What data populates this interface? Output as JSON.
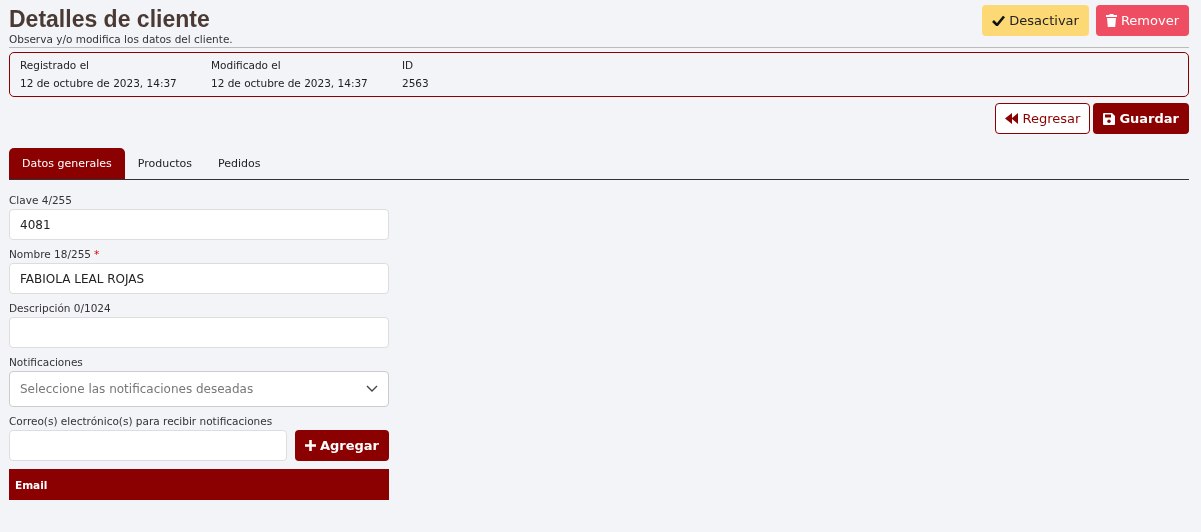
{
  "header": {
    "title": "Detalles de cliente",
    "subtitle": "Observa y/o modifica los datos del cliente."
  },
  "top_actions": [
    {
      "label": "Desactivar",
      "kind": "warning"
    },
    {
      "label": "Remover",
      "kind": "danger"
    }
  ],
  "info": [
    {
      "label": "Registrado el",
      "value": "12 de octubre de 2023, 14:37"
    },
    {
      "label": "Modificado el",
      "value": "12 de octubre de 2023, 14:37"
    },
    {
      "label": "ID",
      "value": "2563"
    }
  ],
  "form_actions": [
    {
      "label": "Regresar",
      "kind": "back"
    },
    {
      "label": "Guardar",
      "kind": "save"
    }
  ],
  "tabs": [
    {
      "label": "Datos generales",
      "selected": true
    },
    {
      "label": "Productos",
      "selected": false
    },
    {
      "label": "Pedidos",
      "selected": false
    }
  ],
  "fields": [
    {
      "kind": "text",
      "label": "Clave 4/255",
      "value": "4081"
    },
    {
      "kind": "text",
      "label": "Nombre 18/255",
      "value": "FABIOLA LEAL ROJAS",
      "required_mark": "*"
    },
    {
      "kind": "text",
      "label": "Descripción 0/1024"
    },
    {
      "kind": "select",
      "label": "Notificaciones",
      "placeholder": "Seleccione las notificaciones deseadas"
    },
    {
      "kind": "add",
      "label": "Correo(s) electrónico(s) para recibir notificaciones",
      "button": "Agregar"
    }
  ],
  "email_table": {
    "columns": [
      "Email"
    ]
  }
}
